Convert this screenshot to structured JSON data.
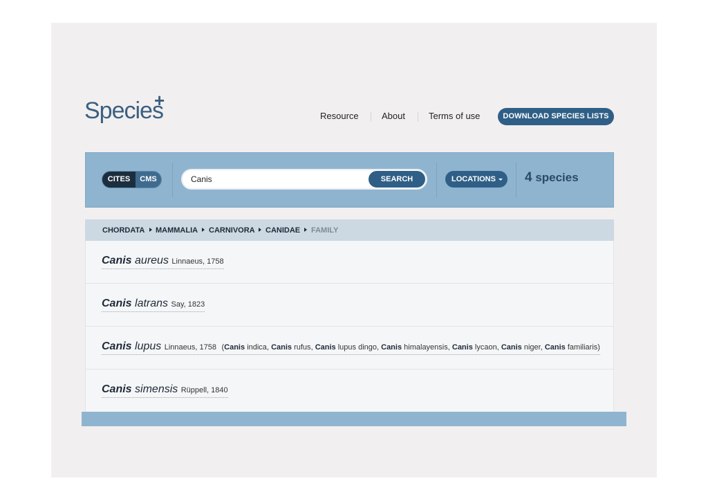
{
  "header": {
    "logo_text": "Species",
    "logo_plus": "+",
    "nav": [
      "Resource",
      "About",
      "Terms of use"
    ],
    "download_label": "DOWNLOAD SPECIES LISTS"
  },
  "search": {
    "toggle": {
      "cites": "CITES",
      "cms": "CMS",
      "selected": "CITES"
    },
    "query": "Canis",
    "button_label": "SEARCH",
    "locations_label": "LOCATIONS",
    "count_number": "4",
    "count_unit": "species"
  },
  "breadcrumb": [
    "CHORDATA",
    "MAMMALIA",
    "CARNIVORA",
    "CANIDAE",
    "FAMILY"
  ],
  "results": [
    {
      "genus": "Canis",
      "epithet": "aureus",
      "author": "Linnaeus, 1758",
      "synonyms": []
    },
    {
      "genus": "Canis",
      "epithet": "latrans",
      "author": "Say, 1823",
      "synonyms": []
    },
    {
      "genus": "Canis",
      "epithet": "lupus",
      "author": "Linnaeus, 1758",
      "synonyms": [
        {
          "genus": "Canis",
          "rest": "indica"
        },
        {
          "genus": "Canis",
          "rest": "rufus"
        },
        {
          "genus": "Canis",
          "rest": "lupus dingo"
        },
        {
          "genus": "Canis",
          "rest": "himalayensis"
        },
        {
          "genus": "Canis",
          "rest": "lycaon"
        },
        {
          "genus": "Canis",
          "rest": "niger"
        },
        {
          "genus": "Canis",
          "rest": "familiaris"
        }
      ]
    },
    {
      "genus": "Canis",
      "epithet": "simensis",
      "author": "Rüppell, 1840",
      "synonyms": []
    }
  ],
  "colors": {
    "accent": "#2f5f86",
    "band": "#8fb4d0",
    "breadcrumb_bg": "#ccd9e3",
    "list_bg": "#f5f6f8"
  }
}
